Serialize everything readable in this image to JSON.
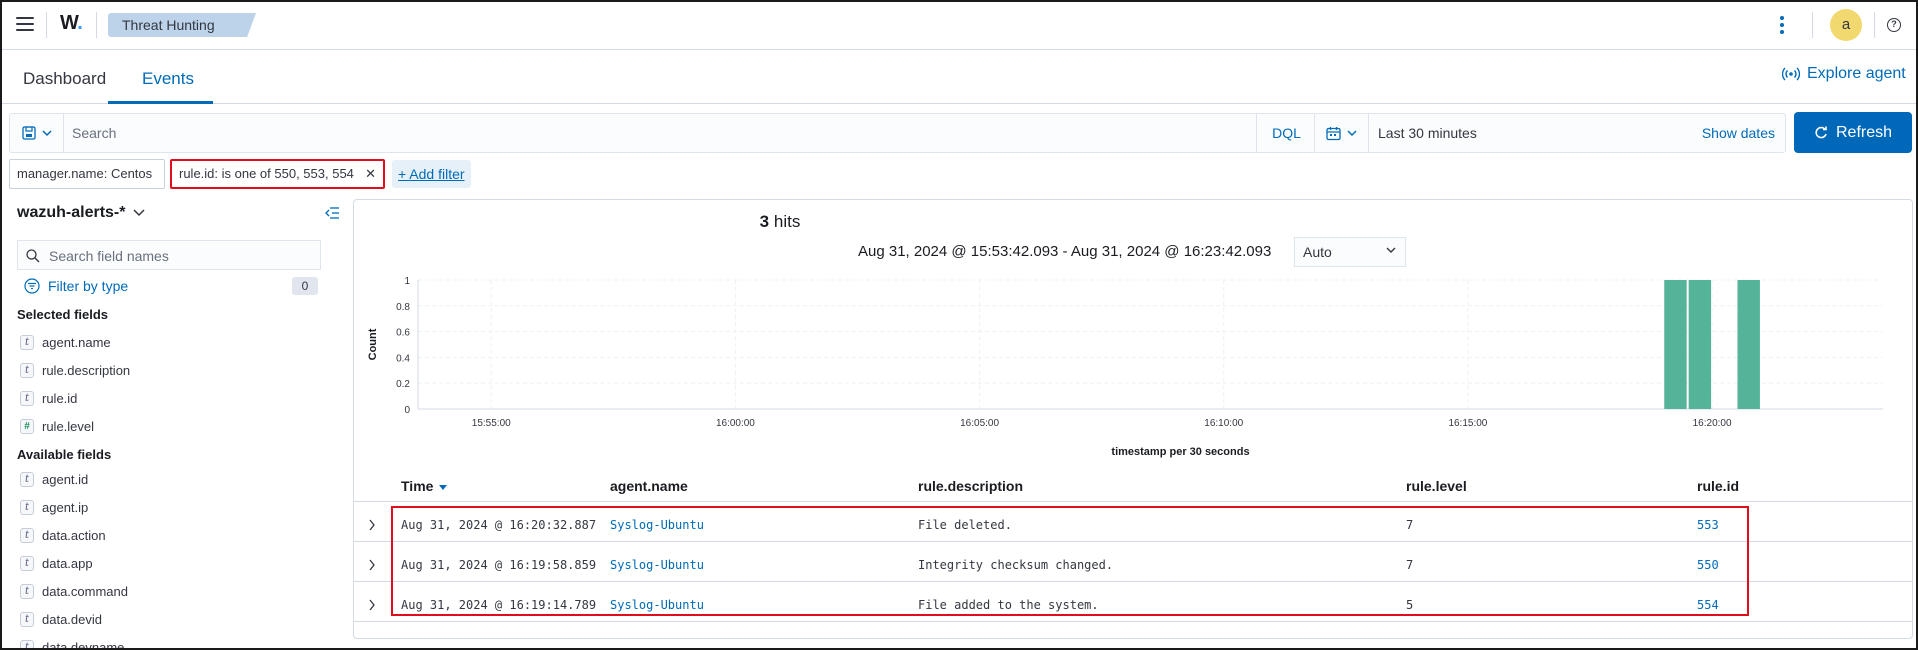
{
  "header": {
    "logo_text": "W",
    "logo_dot": ".",
    "breadcrumb": "Threat Hunting",
    "avatar_letter": "a",
    "help_symbol": "?"
  },
  "tabs": {
    "dashboard": "Dashboard",
    "events": "Events",
    "explore_agent": "Explore agent"
  },
  "query": {
    "search_placeholder": "Search",
    "language": "DQL",
    "time_range": "Last 30 minutes",
    "show_dates": "Show dates",
    "refresh_label": "Refresh"
  },
  "filters": [
    {
      "label": "manager.name: Centos",
      "highlighted": false
    },
    {
      "label": "rule.id: is one of 550, 553, 554",
      "highlighted": true
    }
  ],
  "add_filter": "+ Add filter",
  "sidebar": {
    "index_pattern": "wazuh-alerts-*",
    "field_search_placeholder": "Search field names",
    "filter_by_type": "Filter by type",
    "filter_count": "0",
    "selected_title": "Selected fields",
    "selected": [
      {
        "type": "t",
        "name": "agent.name"
      },
      {
        "type": "t",
        "name": "rule.description"
      },
      {
        "type": "t",
        "name": "rule.id"
      },
      {
        "type": "#",
        "name": "rule.level"
      }
    ],
    "available_title": "Available fields",
    "available": [
      {
        "type": "t",
        "name": "agent.id"
      },
      {
        "type": "t",
        "name": "agent.ip"
      },
      {
        "type": "t",
        "name": "data.action"
      },
      {
        "type": "t",
        "name": "data.app"
      },
      {
        "type": "t",
        "name": "data.command"
      },
      {
        "type": "t",
        "name": "data.devid"
      },
      {
        "type": "t",
        "name": "data.devname"
      }
    ]
  },
  "results": {
    "hits_count": "3",
    "hits_label": "hits",
    "date_range": "Aug 31, 2024 @ 15:53:42.093 - Aug 31, 2024 @ 16:23:42.093",
    "interval": "Auto"
  },
  "chart_data": {
    "type": "bar",
    "ylabel": "Count",
    "xlabel": "timestamp per 30 seconds",
    "y_ticks": [
      "0",
      "0.2",
      "0.4",
      "0.6",
      "0.8",
      "1"
    ],
    "ylim": [
      0,
      1
    ],
    "x_ticks": [
      "15:55:00",
      "16:00:00",
      "16:05:00",
      "16:10:00",
      "16:15:00",
      "16:20:00"
    ],
    "x_range": [
      "15:53:30",
      "16:23:30"
    ],
    "grid": true,
    "color": "#54b399",
    "bars": [
      {
        "x": "16:19:00",
        "value": 1
      },
      {
        "x": "16:19:30",
        "value": 1
      },
      {
        "x": "16:20:30",
        "value": 1
      }
    ]
  },
  "table": {
    "columns": [
      "Time",
      "agent.name",
      "rule.description",
      "rule.level",
      "rule.id"
    ],
    "rows": [
      {
        "time": "Aug 31, 2024 @ 16:20:32.887",
        "agent": "Syslog-Ubuntu",
        "description": "File deleted.",
        "level": "7",
        "rule_id": "553"
      },
      {
        "time": "Aug 31, 2024 @ 16:19:58.859",
        "agent": "Syslog-Ubuntu",
        "description": "Integrity checksum changed.",
        "level": "7",
        "rule_id": "550"
      },
      {
        "time": "Aug 31, 2024 @ 16:19:14.789",
        "agent": "Syslog-Ubuntu",
        "description": "File added to the system.",
        "level": "5",
        "rule_id": "554"
      }
    ]
  }
}
